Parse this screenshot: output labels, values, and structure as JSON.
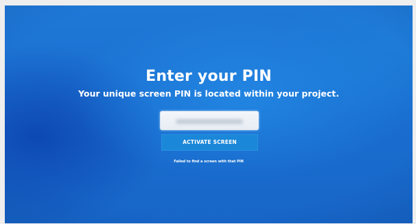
{
  "pin_screen": {
    "title": "Enter your PIN",
    "subtitle": "Your unique screen PIN is located within your project.",
    "pin_input": {
      "value": "",
      "placeholder": ""
    },
    "activate_button_label": "ACTIVATE SCREEN",
    "error_message": "Failed to find a screen with that PIN"
  },
  "colors": {
    "background": "#1a6fd0",
    "button": "#1b87d8",
    "text": "#ffffff",
    "input_background": "#eef2f7"
  }
}
